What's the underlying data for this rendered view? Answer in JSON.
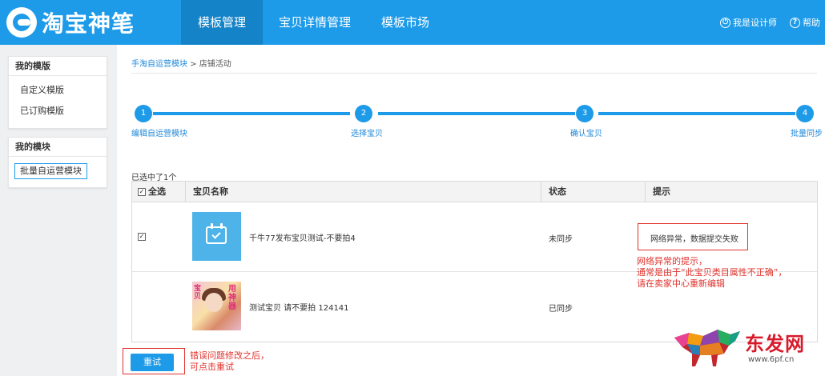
{
  "header": {
    "logo_text": "淘宝神笔",
    "tabs": [
      {
        "label": "模板管理",
        "active": true
      },
      {
        "label": "宝贝详情管理",
        "active": false
      },
      {
        "label": "模板市场",
        "active": false
      }
    ],
    "designer_label": "我是设计师",
    "help_label": "帮助",
    "designer_icon": "power-icon",
    "help_icon": "question-icon",
    "bg_color": "#1e9be8",
    "active_tab_color": "#1583c7"
  },
  "sidebar": {
    "templates_title": "我的模版",
    "template_items": [
      "自定义模版",
      "已订购模版"
    ],
    "modules_title": "我的模块",
    "module_button": "批量自运营模块"
  },
  "breadcrumb": {
    "parent": "手淘自运营模块",
    "separator": " > ",
    "current": "店铺活动"
  },
  "steps": [
    {
      "num": "1",
      "label": "编辑自运营模块"
    },
    {
      "num": "2",
      "label": "选择宝贝"
    },
    {
      "num": "3",
      "label": "确认宝贝"
    },
    {
      "num": "4",
      "label": "批量同步"
    }
  ],
  "selection_count": "已选中了1个",
  "table": {
    "headers": {
      "select_all": "全选",
      "name": "宝贝名称",
      "status": "状态",
      "hint": "提示"
    },
    "rows": [
      {
        "checked": true,
        "name": "千牛77发布宝贝测试-不要拍4",
        "status": "未同步",
        "hint": "网络异常，数据提交失败",
        "image_icon": "calendar-check-icon"
      },
      {
        "checked": false,
        "name": "测试宝贝 请不要拍 124141",
        "status": "已同步",
        "hint": "",
        "image_icon": "product-photo"
      }
    ]
  },
  "annotations": {
    "error_note": [
      "网络异常的提示，",
      "通常是由于“此宝贝类目属性不正确”，",
      "请在卖家中心重新编辑"
    ],
    "retry_note": [
      "错误问题修改之后，",
      "可点击重试"
    ],
    "color": "#e0322c"
  },
  "retry_button": "重试",
  "watermark": {
    "text": "东发网",
    "url": "www.6pf.cn"
  }
}
